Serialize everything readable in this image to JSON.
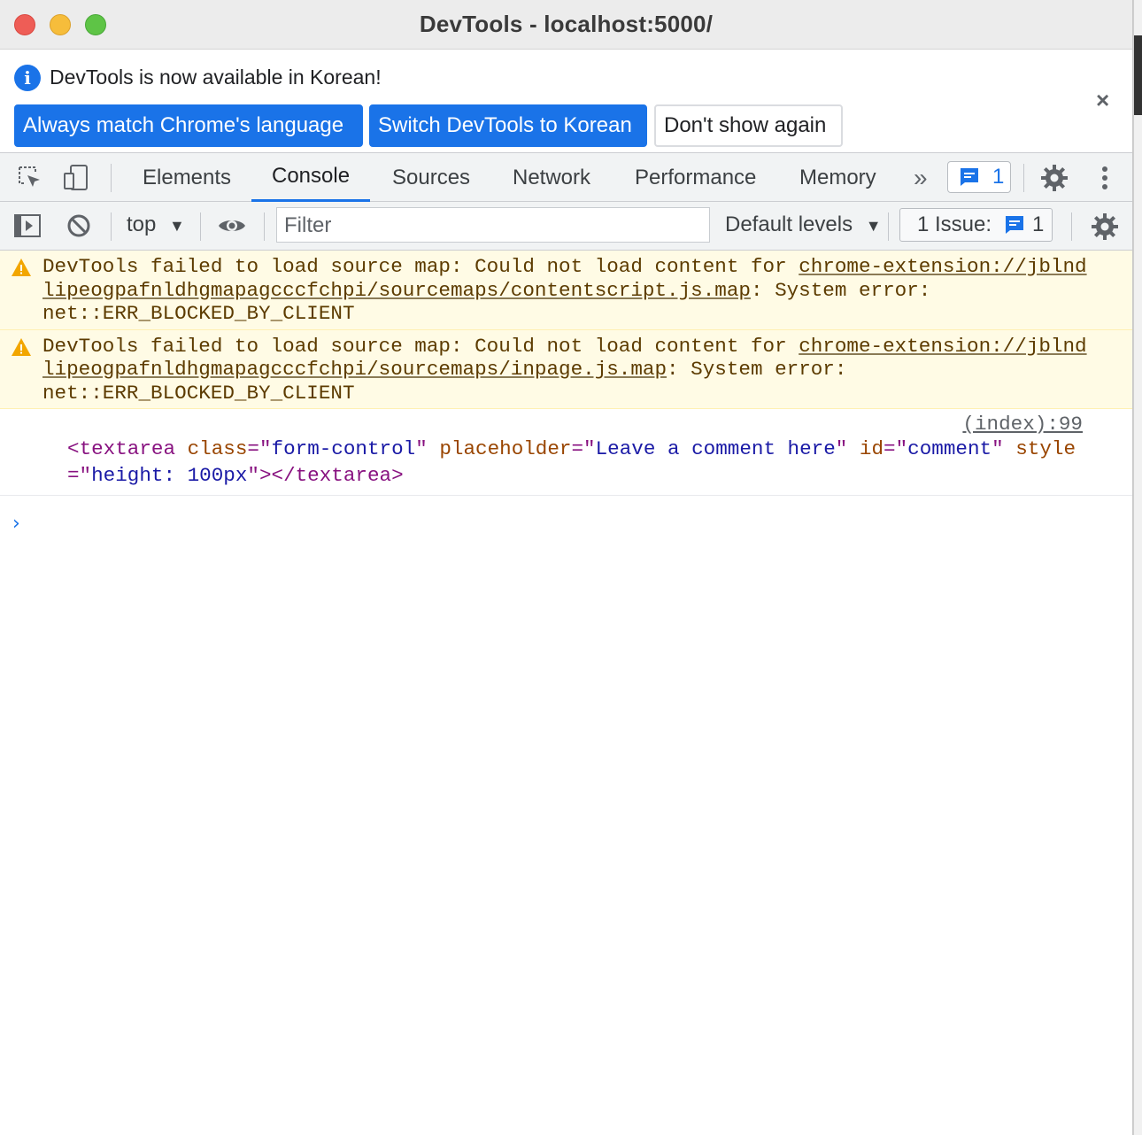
{
  "window": {
    "title": "DevTools - localhost:5000/"
  },
  "infobar": {
    "message": "DevTools is now available in Korean!",
    "buttons": [
      "Always match Chrome's language",
      "Switch DevTools to Korean",
      "Don't show again"
    ],
    "close_glyph": "×"
  },
  "tabs": {
    "items": [
      "Elements",
      "Console",
      "Sources",
      "Network",
      "Performance",
      "Memory"
    ],
    "active": "Console",
    "more_glyph": "»",
    "messages_count": "1"
  },
  "console_toolbar": {
    "context": "top",
    "filter_placeholder": "Filter",
    "levels": "Default levels",
    "issues_label": "1 Issue:",
    "issues_count": "1"
  },
  "messages": [
    {
      "type": "warning",
      "text_before": "DevTools failed to load source map: Could not load content for ",
      "link": "chrome-extension://jblndlipeogpafnldhgmapagcccfchpi/sourcemaps/contentscript.js.map",
      "text_after": ": System error: net::ERR_BLOCKED_BY_CLIENT"
    },
    {
      "type": "warning",
      "text_before": "DevTools failed to load source map: Could not load content for ",
      "link": "chrome-extension://jblndlipeogpafnldhgmapagcccfchpi/sourcemaps/inpage.js.map",
      "text_after": ": System error: net::ERR_BLOCKED_BY_CLIENT"
    },
    {
      "type": "log",
      "source": "(index):99",
      "element": {
        "tag": "textarea",
        "attrs": [
          {
            "name": "class",
            "value": "form-control"
          },
          {
            "name": "placeholder",
            "value": "Leave a comment here"
          },
          {
            "name": "id",
            "value": "comment"
          },
          {
            "name": "style",
            "value": "height: 100px"
          }
        ]
      }
    }
  ],
  "prompt_glyph": "›",
  "colors": {
    "accent": "#1a73e8",
    "warning_bg": "#fffbe5",
    "warning_text": "#5c3b00",
    "tag": "#881280",
    "attr_name": "#994500",
    "attr_value": "#1a1aa6"
  }
}
